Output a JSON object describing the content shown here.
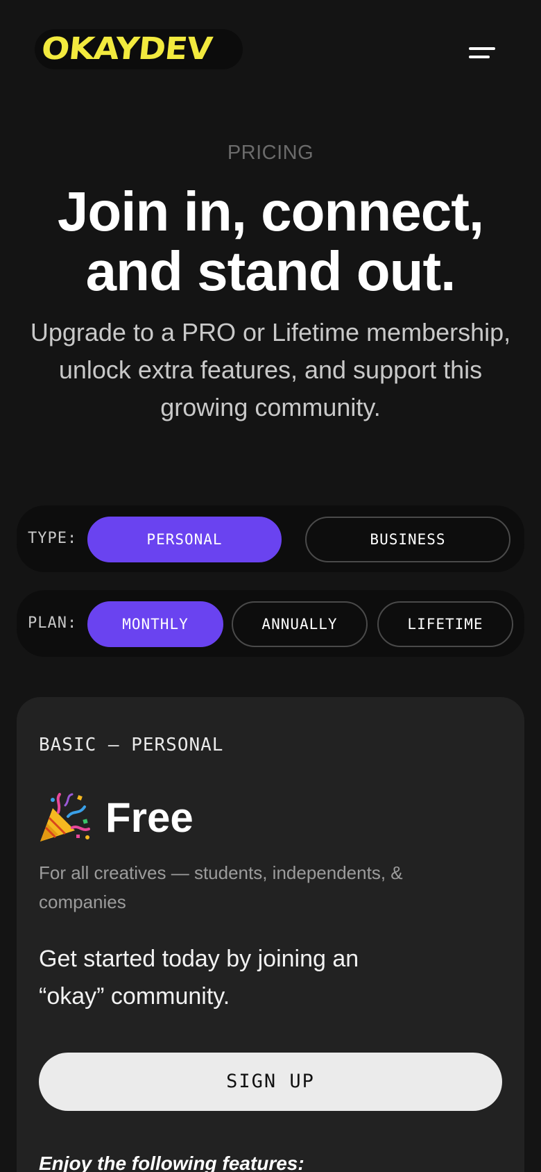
{
  "header": {
    "logo_text": "OKAYDEV",
    "logo_color": "#f2ea3e",
    "menu_icon": "hamburger-menu-icon"
  },
  "hero": {
    "eyebrow": "PRICING",
    "title_line1": "Join in, connect,",
    "title_line2": "and stand out.",
    "subtitle": "Upgrade to a PRO or Lifetime membership, unlock extra features, and support this growing community."
  },
  "type_selector": {
    "label": "TYPE:",
    "options": [
      {
        "label": "PERSONAL",
        "selected": true
      },
      {
        "label": "BUSINESS",
        "selected": false
      }
    ]
  },
  "plan_selector": {
    "label": "PLAN:",
    "options": [
      {
        "label": "MONTHLY",
        "selected": true
      },
      {
        "label": "ANNUALLY",
        "selected": false
      },
      {
        "label": "LIFETIME",
        "selected": false
      }
    ]
  },
  "card": {
    "label": "BASIC — PERSONAL",
    "price_icon": "party-popper-icon",
    "price": "Free",
    "description": "For all creatives — students, independents, & companies",
    "pitch": "Get started today by joining an “okay” community.",
    "cta": "SIGN UP",
    "features_heading": "Enjoy the following features:"
  },
  "colors": {
    "background": "#141414",
    "accent": "#6a43f0",
    "card": "#222222"
  }
}
